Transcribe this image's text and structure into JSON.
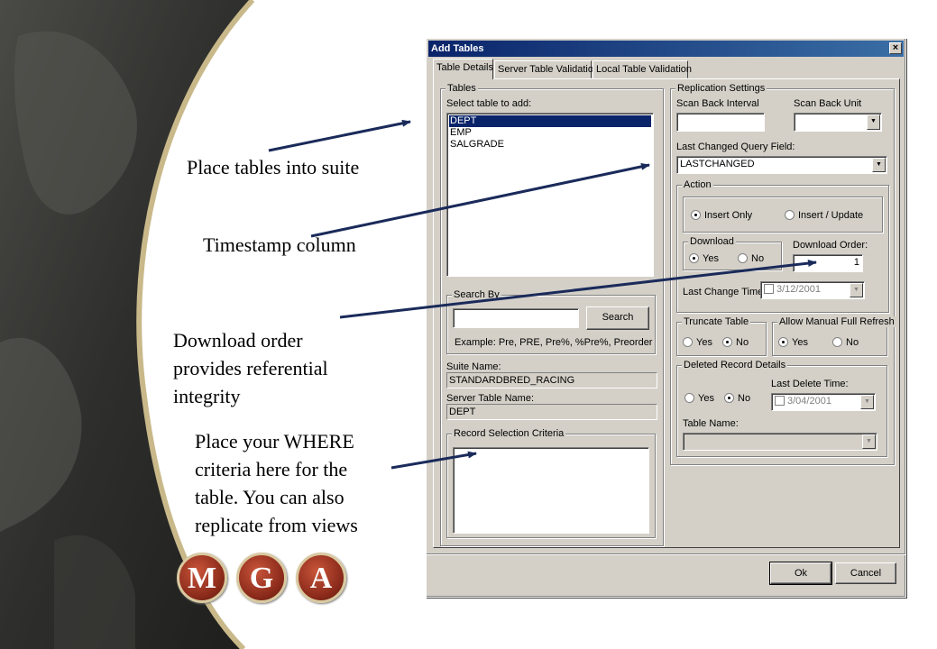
{
  "callouts": {
    "tables": "Place tables into suite",
    "timestamp": "Timestamp column",
    "download_line1": "Download order",
    "download_line2": "provides referential",
    "download_line3": "integrity",
    "where_line1": "Place your WHERE",
    "where_line2": "criteria here for the",
    "where_line3": "table. You can also",
    "where_line4": "replicate from views"
  },
  "logo": {
    "letters": [
      "M",
      "G",
      "A"
    ]
  },
  "dialog": {
    "title": "Add Tables",
    "close_glyph": "×",
    "tabs": [
      "Table Details",
      "Server Table Validation",
      "Local Table Validation"
    ],
    "tables_group": "Tables",
    "select_label": "Select table to add:",
    "table_list": [
      "DEPT",
      "EMP",
      "SALGRADE"
    ],
    "selected_table": "DEPT",
    "search_group": "Search By",
    "search_value": "",
    "search_button": "Search",
    "search_example": "Example:   Pre, PRE, Pre%, %Pre%, Preorder",
    "suite_name_label": "Suite Name:",
    "suite_name_value": "STANDARDBRED_RACING",
    "server_table_label": "Server Table Name:",
    "server_table_value": "DEPT",
    "record_criteria_group": "Record Selection Criteria",
    "record_criteria_value": "",
    "replication_group": "Replication Settings",
    "scan_back_interval_label": "Scan Back Interval",
    "scan_back_interval_value": "",
    "scan_back_unit_label": "Scan Back Unit",
    "scan_back_unit_value": "",
    "last_changed_label": "Last Changed Query Field:",
    "last_changed_value": "LASTCHANGED",
    "action_group": "Action",
    "action_insert_only": "Insert Only",
    "action_insert_update": "Insert / Update",
    "download_group": "Download",
    "yes": "Yes",
    "no": "No",
    "download_order_label": "Download Order:",
    "download_order_value": "1",
    "last_change_time_label": "Last Change Time:",
    "last_change_time_value": "3/12/2001",
    "truncate_group": "Truncate Table",
    "allow_refresh_group": "Allow Manual Full Refresh",
    "deleted_group": "Deleted Record Details",
    "last_delete_time_label": "Last Delete Time:",
    "last_delete_time_value": "3/04/2001",
    "table_name_label": "Table Name:",
    "table_name_value": "",
    "ok_button": "Ok",
    "cancel_button": "Cancel"
  }
}
